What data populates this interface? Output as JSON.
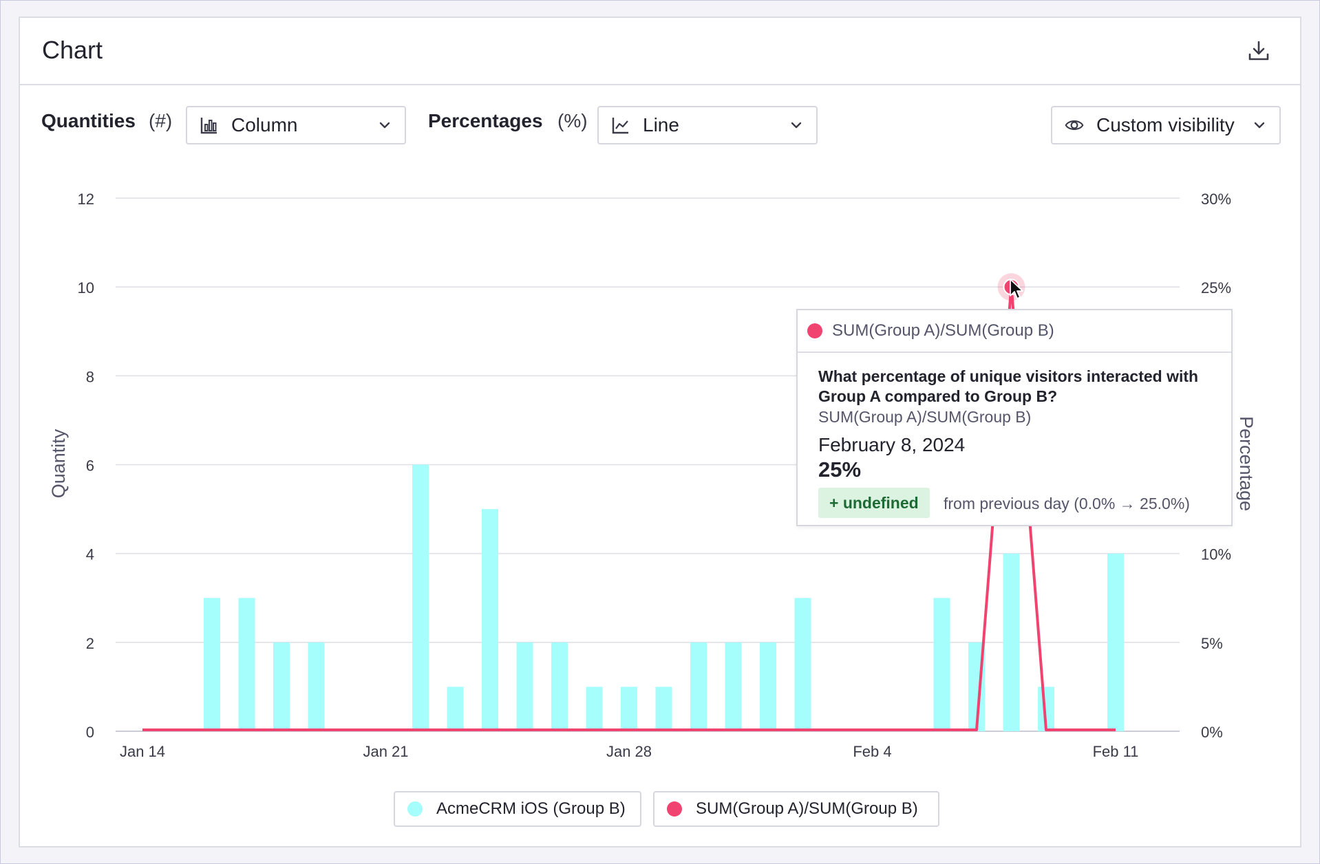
{
  "header": {
    "title": "Chart",
    "download_icon": "download-icon"
  },
  "toolbar": {
    "quantities_label": "Quantities",
    "quantities_unit": "(#)",
    "quantities_select": {
      "value": "Column",
      "icon": "column-chart-icon"
    },
    "percentages_label": "Percentages",
    "percentages_unit": "(%)",
    "percentages_select": {
      "value": "Line",
      "icon": "line-chart-icon"
    },
    "visibility_select": {
      "value": "Custom visibility",
      "icon": "eye-icon"
    }
  },
  "chart_data": {
    "type": "bar",
    "xlabel": "",
    "ylabel": "Quantity",
    "y2label": "Percentage",
    "ylim": [
      0,
      12
    ],
    "y2lim": [
      0,
      30
    ],
    "y_ticks": [
      "0",
      "2",
      "4",
      "6",
      "8",
      "10",
      "12"
    ],
    "y2_ticks": [
      "0%",
      "5%",
      "10%",
      "15%",
      "20%",
      "25%",
      "30%"
    ],
    "x_tick_labels": [
      {
        "label": "Jan 14",
        "index": 0
      },
      {
        "label": "Jan 21",
        "index": 7
      },
      {
        "label": "Jan 28",
        "index": 14
      },
      {
        "label": "Feb 4",
        "index": 21
      },
      {
        "label": "Feb 11",
        "index": 28
      }
    ],
    "grid": true,
    "legend_position": "bottom-center",
    "categories": [
      "Jan 14",
      "Jan 15",
      "Jan 16",
      "Jan 17",
      "Jan 18",
      "Jan 19",
      "Jan 20",
      "Jan 21",
      "Jan 22",
      "Jan 23",
      "Jan 24",
      "Jan 25",
      "Jan 26",
      "Jan 27",
      "Jan 28",
      "Jan 29",
      "Jan 30",
      "Jan 31",
      "Feb 1",
      "Feb 2",
      "Feb 3",
      "Feb 4",
      "Feb 5",
      "Feb 6",
      "Feb 7",
      "Feb 8",
      "Feb 9",
      "Feb 10",
      "Feb 11"
    ],
    "series": [
      {
        "name": "AcmeCRM iOS (Group B)",
        "kind": "column",
        "axis": "left",
        "color": "#a5fdfc",
        "values": [
          0,
          0,
          3,
          3,
          2,
          2,
          0,
          0,
          6,
          1,
          5,
          2,
          2,
          1,
          1,
          1,
          2,
          2,
          2,
          3,
          0,
          0,
          0,
          3,
          2,
          4,
          1,
          0,
          4
        ]
      },
      {
        "name": "SUM(Group A)/SUM(Group B)",
        "kind": "line",
        "axis": "right",
        "color": "#f0436f",
        "values": [
          0,
          0,
          0,
          0,
          0,
          0,
          0,
          0,
          0,
          0,
          0,
          0,
          0,
          0,
          0,
          0,
          0,
          0,
          0,
          0,
          0,
          0,
          0,
          0,
          0,
          25,
          0,
          0,
          0
        ]
      }
    ],
    "highlight_index": 25
  },
  "tooltip": {
    "series": "SUM(Group A)/SUM(Group B)",
    "question": "What percentage of unique visitors interacted with Group A compared to Group B?",
    "subtitle": "SUM(Group A)/SUM(Group B)",
    "date": "February 8, 2024",
    "value": "25%",
    "badge": "+ undefined",
    "change_text": "from previous day (0.0% → 25.0%)"
  },
  "legend": {
    "items": [
      {
        "label": "AcmeCRM iOS (Group B)",
        "color": "#a5fdfc"
      },
      {
        "label": "SUM(Group A)/SUM(Group B)",
        "color": "#f0436f"
      }
    ]
  }
}
